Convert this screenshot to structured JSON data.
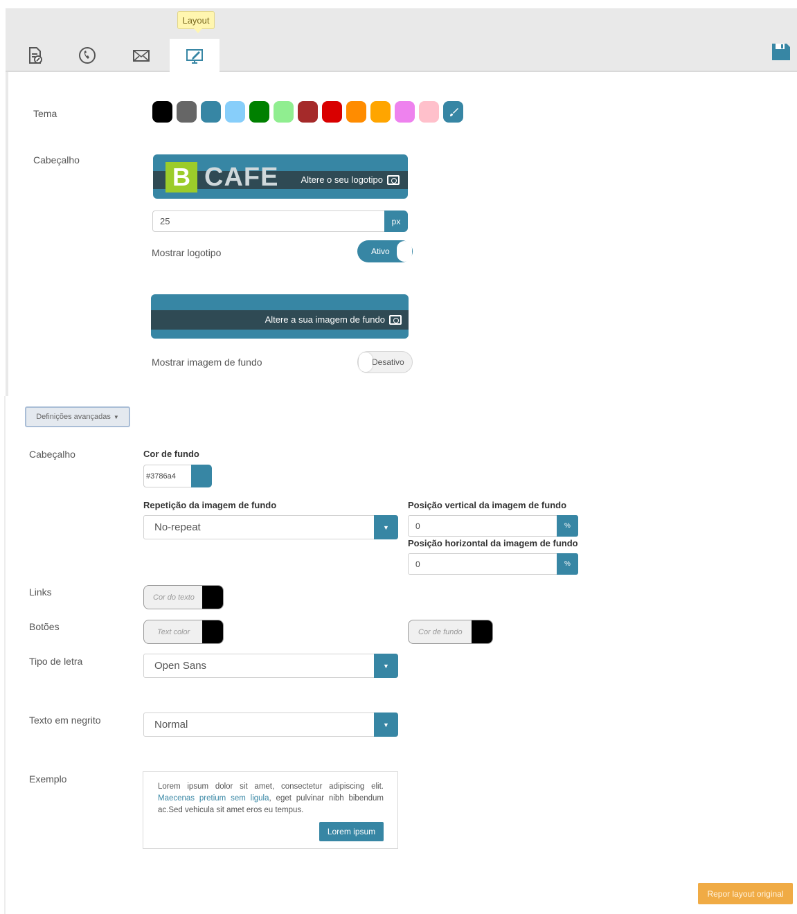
{
  "tabs": {
    "tooltip": "Layout",
    "items": [
      {
        "icon": "document-edit-icon"
      },
      {
        "icon": "phone-icon"
      },
      {
        "icon": "envelope-icon"
      },
      {
        "icon": "monitor-edit-icon",
        "active": true
      }
    ],
    "save_icon": "floppy-disk-icon"
  },
  "theme": {
    "label": "Tema",
    "swatches": [
      "#000000",
      "#666666",
      "#3786a4",
      "#87cefa",
      "#008000",
      "#90ee90",
      "#a52a2a",
      "#d90000",
      "#ff8c00",
      "#ffa500",
      "#ee82ee",
      "#ffc0cb"
    ],
    "custom_icon": "brush-icon",
    "custom_color": "#3786a4"
  },
  "header": {
    "label": "Cabeçalho",
    "logo_b": "B",
    "logo_text": "CAFE",
    "change_logo": "Altere o seu logotipo",
    "logo_size_value": "25",
    "logo_size_unit": "px",
    "show_logo_label": "Mostrar logotipo",
    "show_logo_state": "Ativo",
    "change_background": "Altere a sua imagem de fundo",
    "show_background_label": "Mostrar imagem de fundo",
    "show_background_state": "Desativo"
  },
  "advanced": {
    "button_label": "Definições avançadas",
    "header_label": "Cabeçalho",
    "bg_color_title": "Cor de fundo",
    "bg_color_value": "#3786a4",
    "repeat_title": "Repetição da imagem de fundo",
    "repeat_value": "No-repeat",
    "vpos_title": "Posição vertical da imagem de fundo",
    "vpos_value": "0",
    "hpos_title": "Posição horizontal da imagem de fundo",
    "hpos_value": "0",
    "percent": "%",
    "links_label": "Links",
    "links_placeholder": "Cor do texto",
    "buttons_label": "Botões",
    "buttons_text_placeholder": "Text color",
    "buttons_bg_placeholder": "Cor de fundo",
    "font_label": "Tipo de letra",
    "font_value": "Open Sans",
    "bold_label": "Texto em negrito",
    "bold_value": "Normal",
    "example_label": "Exemplo",
    "example_text_1": "Lorem ipsum dolor sit amet, consectetur adipiscing elit.",
    "example_link": "Maecenas pretium sem ligula",
    "example_text_2": ", eget pulvinar nibh bibendum ac.Sed vehicula sit amet eros eu tempus.",
    "example_button": "Lorem ipsum",
    "reset_button": "Repor layout original"
  }
}
